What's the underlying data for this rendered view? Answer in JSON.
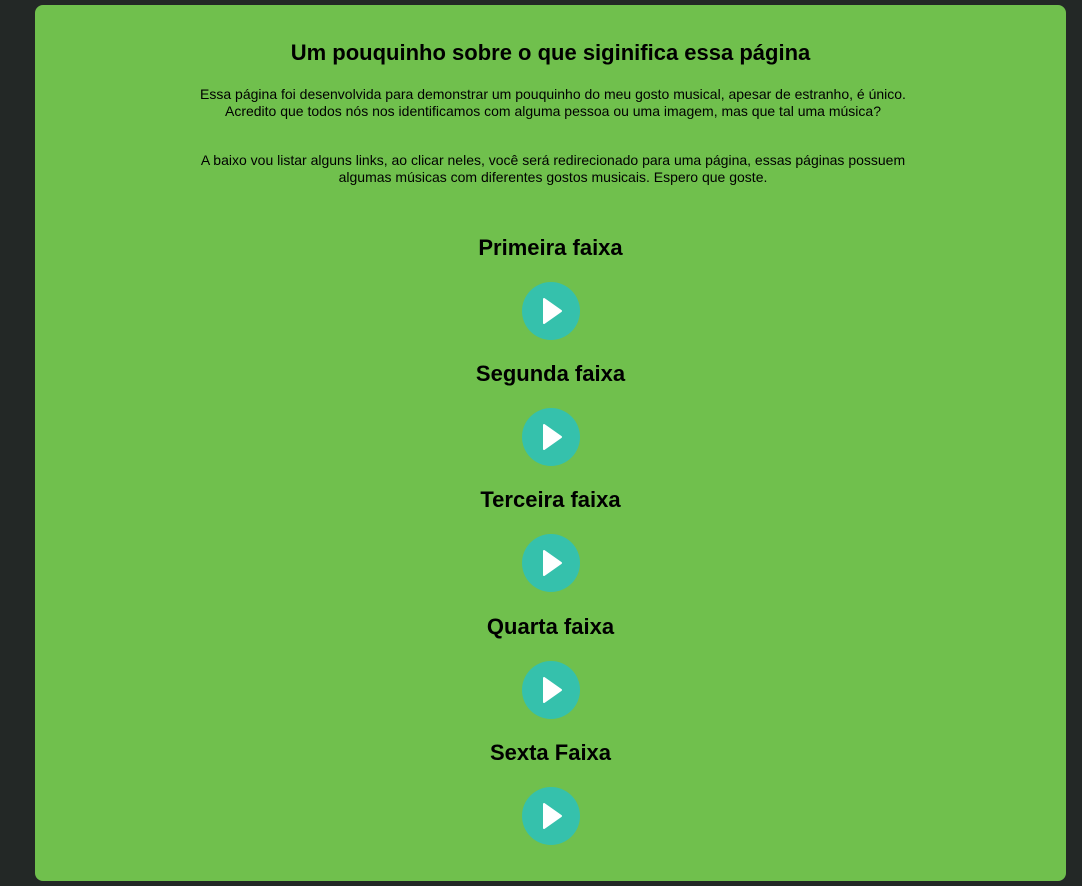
{
  "header": {
    "title": "Um pouquinho sobre o que siginifica essa página"
  },
  "intro": {
    "paragraph_1": "Essa página foi desenvolvida para demonstrar um pouquinho do meu gosto musical, apesar de estranho, é único. Acredito que todos nós nos identificamos com alguma pessoa ou uma imagem, mas que tal uma música?",
    "paragraph_2": "A baixo vou listar alguns links, ao clicar neles, você será redirecionado para uma página, essas páginas possuem algumas músicas com diferentes gostos musicais. Espero que goste."
  },
  "tracks": [
    {
      "title": "Primeira faixa",
      "icon": "play-icon"
    },
    {
      "title": "Segunda faixa",
      "icon": "play-icon"
    },
    {
      "title": "Terceira faixa",
      "icon": "play-icon"
    },
    {
      "title": "Quarta faixa",
      "icon": "play-icon"
    },
    {
      "title": "Sexta Faixa",
      "icon": "play-icon"
    }
  ],
  "colors": {
    "background": "#232826",
    "panel": "#70c04d",
    "play_button": "#35c1ac",
    "play_icon": "#ffffff"
  }
}
